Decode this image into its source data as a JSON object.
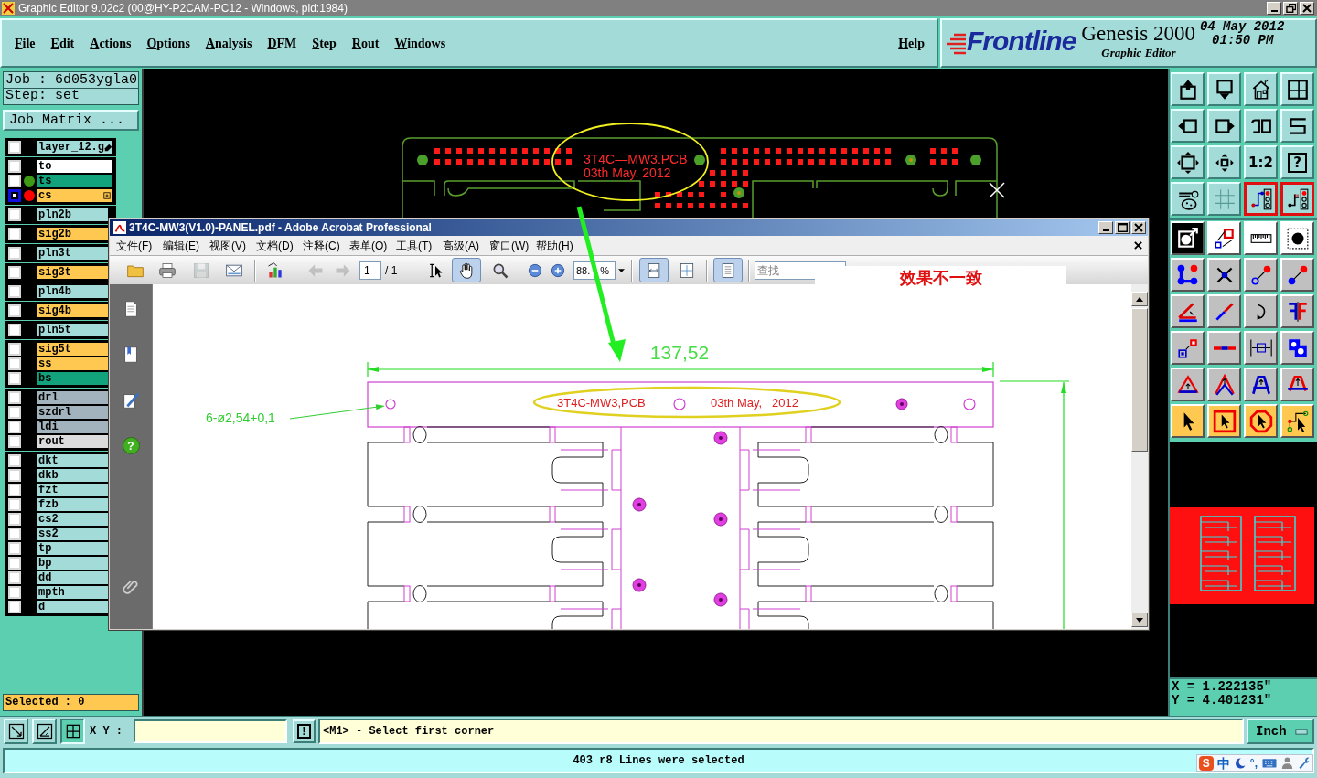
{
  "window": {
    "title": "Graphic Editor 9.02c2 (00@HY-P2CAM-PC12 - Windows, pid:1984)"
  },
  "menu": [
    "File",
    "Edit",
    "Actions",
    "Options",
    "Analysis",
    "DFM",
    "Step",
    "Rout",
    "Windows"
  ],
  "help_menu": "Help",
  "branding": {
    "logo": "Frontline",
    "product": "Genesis 2000",
    "date": "04 May 2012",
    "time": "01:50 PM",
    "subtitle": "Graphic Editor"
  },
  "job_panel": {
    "job": "Job : 6d053ygla0",
    "step": "Step: set",
    "matrix_button": "Job Matrix ..."
  },
  "layer_groups": [
    {
      "layers": [
        {
          "name": "layer_12.g",
          "kind": "document",
          "selected": false,
          "edited": true
        }
      ]
    },
    {
      "layers": [
        {
          "name": "to",
          "kind": "silk_screen",
          "selected": false,
          "edited": false
        },
        {
          "name": "ts",
          "kind": "solder_mask",
          "selected": false,
          "edited": false,
          "color": "#3c9a14"
        },
        {
          "name": "cs",
          "kind": "signal",
          "selected": true,
          "edited": false,
          "color": "#ff0000"
        }
      ]
    },
    {
      "layers": [
        {
          "name": "pln2b",
          "kind": "power_ground",
          "selected": false,
          "edited": false
        }
      ]
    },
    {
      "layers": [
        {
          "name": "sig2b",
          "kind": "signal",
          "selected": false,
          "edited": false
        }
      ]
    },
    {
      "layers": [
        {
          "name": "pln3t",
          "kind": "power_ground",
          "selected": false,
          "edited": false
        }
      ]
    },
    {
      "layers": [
        {
          "name": "sig3t",
          "kind": "signal",
          "selected": false,
          "edited": false
        }
      ]
    },
    {
      "layers": [
        {
          "name": "pln4b",
          "kind": "power_ground",
          "selected": false,
          "edited": false
        }
      ]
    },
    {
      "layers": [
        {
          "name": "sig4b",
          "kind": "signal",
          "selected": false,
          "edited": false
        }
      ]
    },
    {
      "layers": [
        {
          "name": "pln5t",
          "kind": "power_ground",
          "selected": false,
          "edited": false
        }
      ]
    },
    {
      "layers": [
        {
          "name": "sig5t",
          "kind": "signal",
          "selected": false,
          "edited": false
        },
        {
          "name": "ss",
          "kind": "signal",
          "selected": false,
          "edited": false
        },
        {
          "name": "bs",
          "kind": "solder_mask",
          "selected": false,
          "edited": false
        }
      ]
    },
    {
      "layers": [
        {
          "name": "drl",
          "kind": "drill",
          "selected": false,
          "edited": false
        },
        {
          "name": "szdrl",
          "kind": "drill",
          "selected": false,
          "edited": false
        },
        {
          "name": "ldi",
          "kind": "drill",
          "selected": false,
          "edited": false
        },
        {
          "name": "rout",
          "kind": "rout",
          "selected": false,
          "edited": false
        }
      ]
    },
    {
      "layers": [
        {
          "name": "dkt",
          "kind": "document",
          "selected": false,
          "edited": false
        },
        {
          "name": "dkb",
          "kind": "document",
          "selected": false,
          "edited": false
        },
        {
          "name": "fzt",
          "kind": "document",
          "selected": false,
          "edited": false
        },
        {
          "name": "fzb",
          "kind": "document",
          "selected": false,
          "edited": false
        },
        {
          "name": "cs2",
          "kind": "document",
          "selected": false,
          "edited": false
        },
        {
          "name": "ss2",
          "kind": "document",
          "selected": false,
          "edited": false
        },
        {
          "name": "tp",
          "kind": "document",
          "selected": false,
          "edited": false
        },
        {
          "name": "bp",
          "kind": "document",
          "selected": false,
          "edited": false
        },
        {
          "name": "dd",
          "kind": "document",
          "selected": false,
          "edited": false
        },
        {
          "name": "mpth",
          "kind": "document",
          "selected": false,
          "edited": false
        },
        {
          "name": "d",
          "kind": "document",
          "selected": false,
          "edited": false
        }
      ]
    }
  ],
  "selected_count": "Selected : 0",
  "canvas": {
    "labels": [
      "3T4C—MW3.PCB",
      "03th May. 2012"
    ]
  },
  "view_toolbar": [
    {
      "on": false
    },
    {
      "on": false
    },
    {
      "on": false
    },
    {
      "on": false
    },
    {
      "on": false
    },
    {
      "on": false
    },
    {
      "on": false
    },
    {
      "on": false
    },
    {
      "on": false
    },
    {
      "on": false
    },
    {
      "label": "1:2",
      "on": false
    },
    {
      "label": "?",
      "on": false
    },
    {
      "on": false
    },
    {
      "on": false
    },
    {
      "on": true
    },
    {
      "on": true
    }
  ],
  "edit_toolbar": [
    {
      "on": true
    },
    {
      "on": false
    },
    {
      "on": false
    },
    {
      "on": false
    },
    {
      "on": false
    },
    {
      "on": false
    },
    {
      "on": false
    },
    {
      "on": false
    },
    {
      "on": false
    },
    {
      "on": false
    },
    {
      "on": false
    },
    {
      "on": false
    },
    {
      "on": false
    },
    {
      "on": false
    },
    {
      "on": false
    },
    {
      "on": false
    },
    {
      "on": false
    },
    {
      "on": false
    },
    {
      "on": false
    },
    {
      "on": false
    },
    {
      "on": false
    },
    {
      "on": false
    },
    {
      "on": false
    },
    {
      "on": false
    }
  ],
  "coordinates": {
    "x": "X = 1.222135\"",
    "y": "Y = 4.401231\""
  },
  "command_bar": {
    "tools": [
      {
        "on": false
      },
      {
        "on": false
      },
      {
        "on": true
      }
    ],
    "xy_label": "X Y :",
    "alert_button": "!",
    "message": "<M1> - Select first corner",
    "units": "Inch"
  },
  "status_bar": {
    "message": "403 r8 Lines were selected",
    "ime": {
      "logo": "S",
      "mode": "中",
      "punctuation": "°,"
    }
  },
  "acrobat": {
    "title": "3T4C-MW3(V1.0)-PANEL.pdf - Adobe Acrobat Professional",
    "menu": [
      "文件(F)",
      "编辑(E)",
      "视图(V)",
      "文档(D)",
      "注释(C)",
      "表单(O)",
      "工具(T)",
      "高级(A)",
      "窗口(W)",
      "帮助(H)"
    ],
    "toolbar": [
      {
        "on": false,
        "disabled": false
      },
      {
        "on": false,
        "disabled": false
      },
      {
        "on": false,
        "disabled": true
      },
      {
        "on": false,
        "disabled": false
      },
      {
        "on": false,
        "disabled": false
      },
      {
        "on": false,
        "disabled": true
      },
      {
        "on": false,
        "disabled": true
      },
      {
        "on": false,
        "disabled": false
      },
      {
        "on": true,
        "disabled": false
      },
      {
        "on": false,
        "disabled": false
      },
      {
        "on": false,
        "disabled": false
      },
      {
        "on": false,
        "disabled": false
      },
      {
        "on": true,
        "disabled": false
      },
      {
        "on": false,
        "disabled": false
      },
      {
        "on": true,
        "disabled": false
      }
    ],
    "page": "1",
    "page_count": "/ 1",
    "zoom": "88.",
    "zoom_suffix": "%",
    "search_placeholder": "查找",
    "nav_help": "?",
    "annotation": "效果不一致",
    "document": {
      "width_dimension": "137,52",
      "hole_callout": "6-ø2,54+0,1",
      "labels": [
        "3T4C-MW3,PCB",
        "03th May,   2012"
      ]
    }
  }
}
